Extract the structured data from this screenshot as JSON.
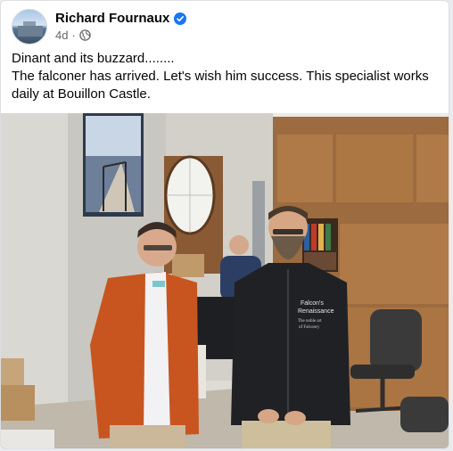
{
  "post": {
    "author": "Richard Fournaux",
    "time": "4d",
    "separator": "·",
    "audience_icon": "globe-icon",
    "verified_icon": "verified-badge-icon",
    "line1": "Dinant and its buzzard........",
    "line2": "The falconer has arrived. Let's wish him success. This specialist works daily at Bouillon Castle."
  },
  "photo": {
    "jacket_text_1": "Falcon's",
    "jacket_text_2": "Renaissance",
    "jacket_text_3": "The noble art",
    "jacket_text_4": "of Falconry"
  },
  "colors": {
    "verified": "#1877f2",
    "text": "#050505",
    "meta": "#65676b"
  }
}
